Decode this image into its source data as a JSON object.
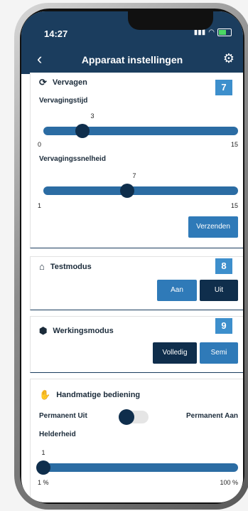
{
  "status": {
    "time": "14:27"
  },
  "appbar": {
    "title": "Apparaat instellingen"
  },
  "vervagen": {
    "title": "Vervagen",
    "badge": "7",
    "tijd_label": "Vervagingstijd",
    "tijd_value": "3",
    "tijd_min": "0",
    "tijd_max": "15",
    "snelheid_label": "Vervagingssnelheid",
    "snelheid_value": "7",
    "snelheid_min": "1",
    "snelheid_max": "15",
    "send_label": "Verzenden"
  },
  "testmodus": {
    "title": "Testmodus",
    "badge": "8",
    "on_label": "Aan",
    "off_label": "Uit"
  },
  "werkingsmodus": {
    "title": "Werkingsmodus",
    "badge": "9",
    "full_label": "Volledig",
    "semi_label": "Semi"
  },
  "handmatig": {
    "title": "Handmatige bediening",
    "off_label": "Permanent Uit",
    "on_label": "Permanent Aan",
    "helderheid_label": "Helderheid",
    "helderheid_value": "1",
    "helderheid_min": "1 %",
    "helderheid_max": "100 %"
  }
}
